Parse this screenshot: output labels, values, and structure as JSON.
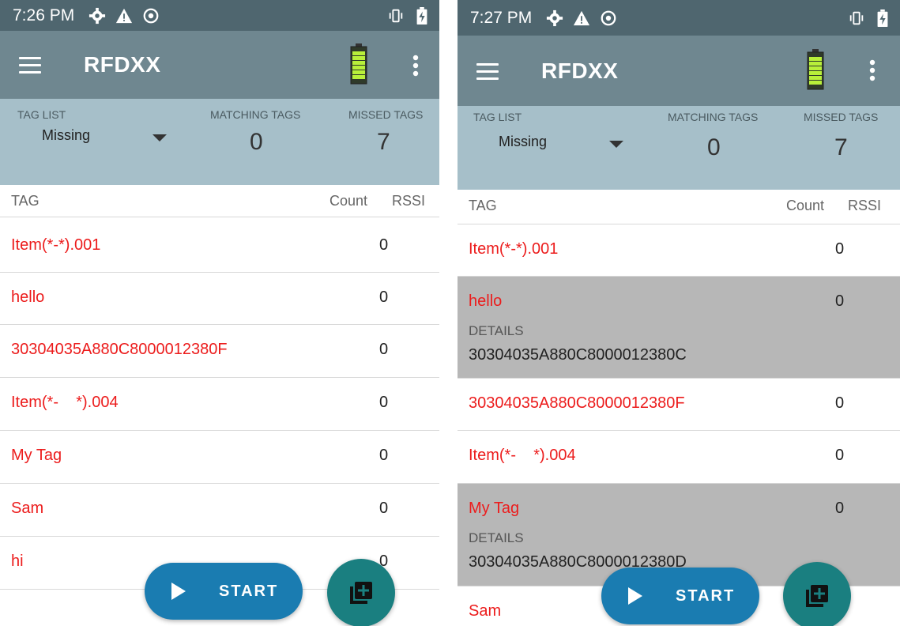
{
  "app_title": "RFDXX",
  "left": {
    "status_time": "7:26 PM",
    "tag_list_label": "TAG LIST",
    "tag_list_value": "Missing",
    "matching_label": "MATCHING TAGS",
    "matching_value": "0",
    "missed_label": "MISSED TAGS",
    "missed_value": "7",
    "col_tag": "TAG",
    "col_count": "Count",
    "col_rssi": "RSSI",
    "rows": [
      {
        "name": "Item(*-*).001",
        "count": "0"
      },
      {
        "name": "hello",
        "count": "0"
      },
      {
        "name": "30304035A880C8000012380F",
        "count": "0"
      },
      {
        "name": "Item(*-    *).004",
        "count": "0"
      },
      {
        "name": "My Tag",
        "count": "0"
      },
      {
        "name": "Sam",
        "count": "0"
      },
      {
        "name": "hi",
        "count": "0"
      }
    ],
    "start_label": "START"
  },
  "right": {
    "status_time": "7:27 PM",
    "tag_list_label": "TAG LIST",
    "tag_list_value": "Missing",
    "matching_label": "MATCHING TAGS",
    "matching_value": "0",
    "missed_label": "MISSED TAGS",
    "missed_value": "7",
    "col_tag": "TAG",
    "col_count": "Count",
    "col_rssi": "RSSI",
    "rows": [
      {
        "name": "Item(*-*).001",
        "count": "0"
      },
      {
        "name": "hello",
        "count": "0",
        "details_label": "DETAILS",
        "details": "30304035A880C8000012380C"
      },
      {
        "name": "30304035A880C8000012380F",
        "count": "0"
      },
      {
        "name": "Item(*-    *).004",
        "count": "0"
      },
      {
        "name": "My Tag",
        "count": "0",
        "details_label": "DETAILS",
        "details": "30304035A880C8000012380D"
      },
      {
        "name": "Sam",
        "count": ""
      }
    ],
    "start_label": "START"
  },
  "icons": {
    "status": [
      "settings-icon",
      "warning-icon",
      "sync-icon",
      "vibrate-icon",
      "battery-charging-icon"
    ],
    "toolbar": [
      "menu-icon",
      "reader-battery-icon",
      "overflow-menu-icon"
    ],
    "actions": [
      "play-icon",
      "add-to-list-icon"
    ]
  },
  "colors": {
    "statusbar": "#4f666f",
    "toolbar": "#6f8790",
    "summary": "#a6bfc9",
    "tag_text": "#ec1c1c",
    "expanded_row": "#b7b7b7",
    "start_button": "#1a7cb1",
    "fab": "#1a7f80"
  }
}
